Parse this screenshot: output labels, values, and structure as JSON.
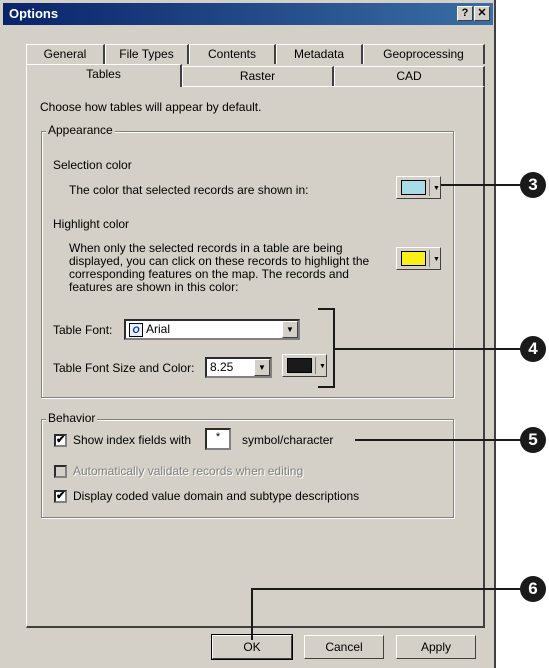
{
  "window": {
    "title": "Options"
  },
  "titlebar_buttons": {
    "help": "?",
    "close": "✕"
  },
  "tabs": {
    "row_back": [
      "General",
      "File Types",
      "Contents",
      "Metadata",
      "Geoprocessing"
    ],
    "row_front": [
      "Tables",
      "Raster",
      "CAD"
    ],
    "active": "Tables"
  },
  "tables_page": {
    "intro": "Choose how tables will appear by default.",
    "appearance": {
      "group_label": "Appearance",
      "selection_color_label": "Selection color",
      "selection_color_desc": "The color that selected records are shown in:",
      "selection_color": "#a8dce8",
      "highlight_color_label": "Highlight color",
      "highlight_desc_lines": [
        "When only the selected records in a table are being",
        "displayed, you can click on these records to highlight the",
        "corresponding features on the map. The records and",
        "features are shown in this color:"
      ],
      "highlight_color": "#f8f018",
      "table_font_label": "Table Font:",
      "table_font_value": "Arial",
      "font_size_label": "Table Font Size and Color:",
      "font_size_value": "8.25",
      "font_color": "#1a1a1a"
    },
    "behavior": {
      "group_label": "Behavior",
      "show_index_label": "Show index fields with",
      "show_index_checked": true,
      "index_symbol": "*",
      "symbol_suffix": "symbol/character",
      "auto_validate_label": "Automatically validate records when editing",
      "auto_validate_checked": false,
      "auto_validate_enabled": false,
      "display_coded_label": "Display coded value domain and subtype descriptions",
      "display_coded_checked": true
    }
  },
  "buttons": {
    "ok": "OK",
    "cancel": "Cancel",
    "apply": "Apply"
  },
  "callouts": [
    "3",
    "4",
    "5",
    "6"
  ]
}
